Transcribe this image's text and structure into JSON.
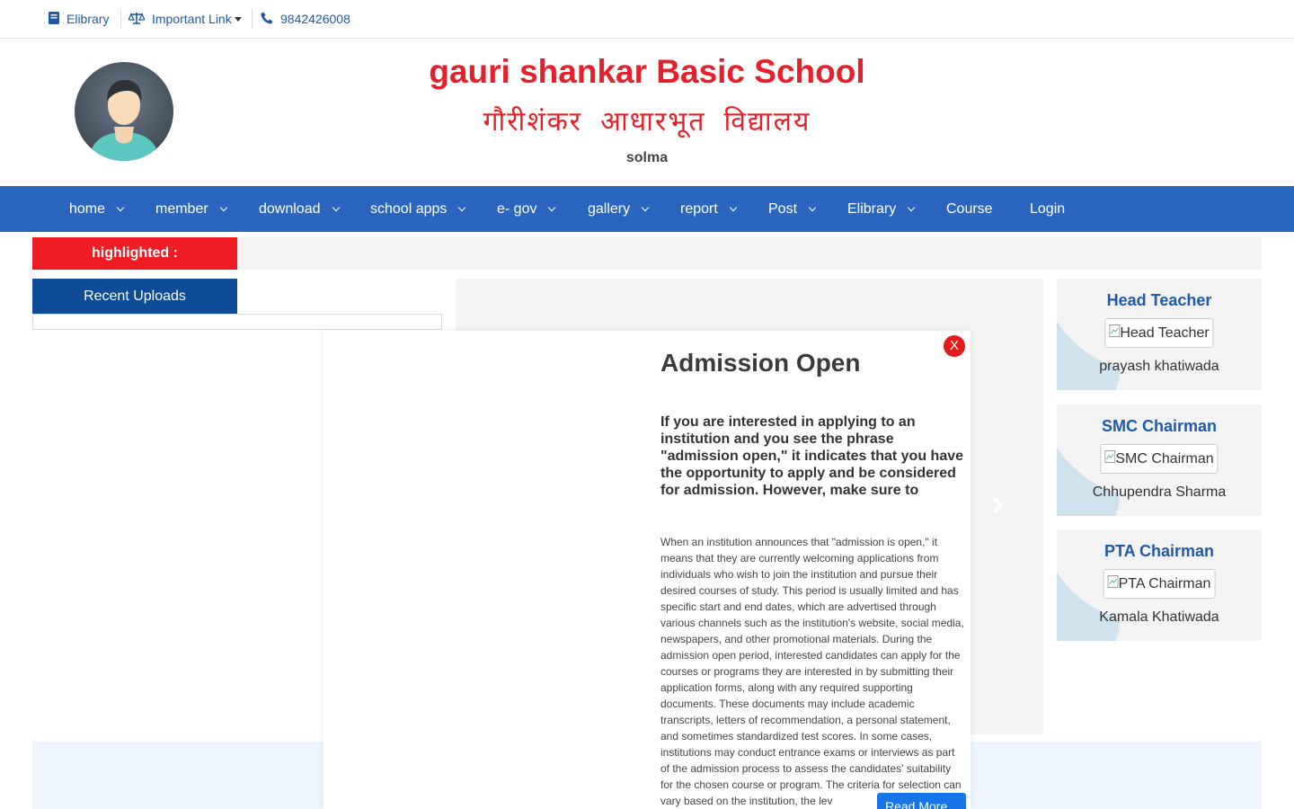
{
  "topbar": {
    "elibrary": "Elibrary",
    "important_link": "Important Link",
    "phone": "9842426008"
  },
  "header": {
    "title": "gauri shankar Basic School",
    "subtitle": "गौरीशंकर आधारभूत विद्यालय",
    "location": "solma"
  },
  "nav": {
    "items": [
      {
        "label": "home"
      },
      {
        "label": "member"
      },
      {
        "label": "download"
      },
      {
        "label": "school apps"
      },
      {
        "label": "e- gov"
      },
      {
        "label": "gallery"
      },
      {
        "label": "report"
      },
      {
        "label": "Post"
      },
      {
        "label": "Elibrary"
      },
      {
        "label": "Course"
      },
      {
        "label": "Login"
      }
    ]
  },
  "highlight": {
    "label": "highlighted :"
  },
  "recent_uploads": {
    "label": "Recent Uploads"
  },
  "cards": [
    {
      "title": "Head Teacher",
      "img_alt": "Head Teacher",
      "name": "prayash khatiwada"
    },
    {
      "title": "SMC Chairman",
      "img_alt": "SMC Chairman",
      "name": "Chhupendra Sharma"
    },
    {
      "title": "PTA Chairman",
      "img_alt": "PTA Chairman",
      "name": "Kamala Khatiwada"
    }
  ],
  "modal": {
    "close": "X",
    "title": "Admission Open",
    "lead": "If you are interested in applying to an institution and you see the phrase \"admission open,\" it indicates that you have the opportunity to apply and be considered for admission. However, make sure to",
    "body": "When an institution announces that \"admission is open,\" it means that they are currently welcoming applications from individuals who wish to join the institution and pursue their desired courses of study. This period is usually limited and has specific start and end dates, which are advertised through various channels such as the institution's website, social media, newspapers, and other promotional materials. During the admission open period, interested candidates can apply for the courses or programs they are interested in by submitting their application forms, along with any required supporting documents. These documents may include academic transcripts, letters of recommendation, a personal statement, and sometimes standardized test scores. In some cases, institutions may conduct entrance exams or interviews as part of the admission process to assess the candidates' suitability for the chosen course or program. The criteria for selection can vary based on the institution, the lev",
    "read_more": "Read More"
  },
  "colors": {
    "brand_red": "#e3212a",
    "nav_blue": "#2a66c0",
    "dark_blue": "#0e4c97"
  }
}
